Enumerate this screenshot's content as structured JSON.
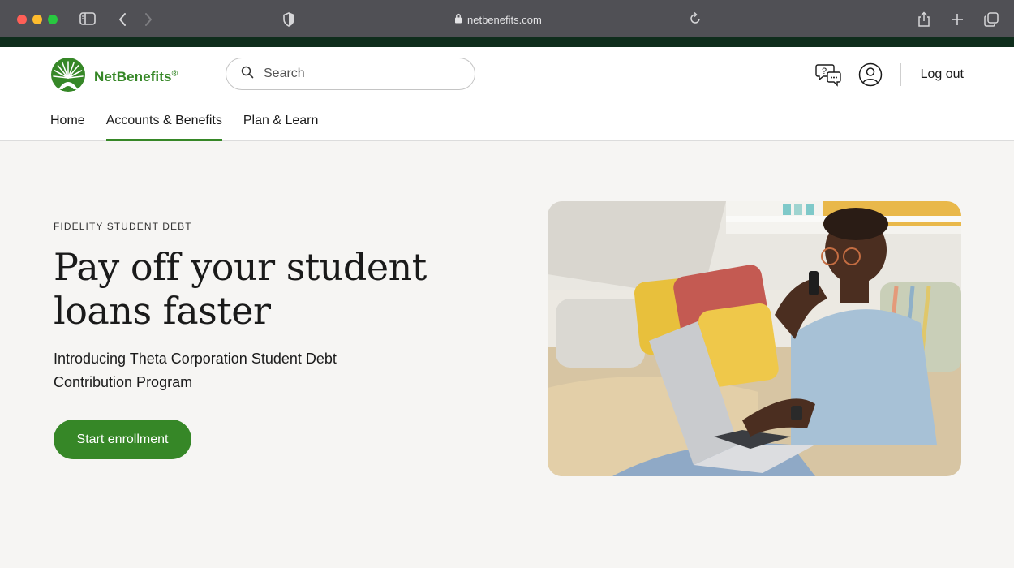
{
  "browser": {
    "url": "netbenefits.com"
  },
  "header": {
    "logo_text": "NetBenefits",
    "logo_mark": "®",
    "search_placeholder": "Search",
    "logout_label": "Log out",
    "nav": [
      {
        "label": "Home",
        "active": false
      },
      {
        "label": "Accounts & Benefits",
        "active": true
      },
      {
        "label": "Plan & Learn",
        "active": false
      }
    ]
  },
  "hero": {
    "eyebrow": "FIDELITY STUDENT DEBT",
    "headline_line1": "Pay off your student",
    "headline_line2": "loans faster",
    "subtext_line1": "Introducing Theta Corporation Student Debt",
    "subtext_line2": "Contribution Program",
    "cta_label": "Start enrollment"
  },
  "colors": {
    "brand_green": "#368727",
    "dark_green_strip": "#0f2d1c",
    "page_bg": "#f6f5f3"
  },
  "icons": [
    "sidebar-icon",
    "back-icon",
    "forward-icon",
    "shield-icon",
    "lock-icon",
    "reload-icon",
    "share-icon",
    "new-tab-icon",
    "tabs-icon",
    "search-icon",
    "chat-help-icon",
    "profile-icon"
  ]
}
